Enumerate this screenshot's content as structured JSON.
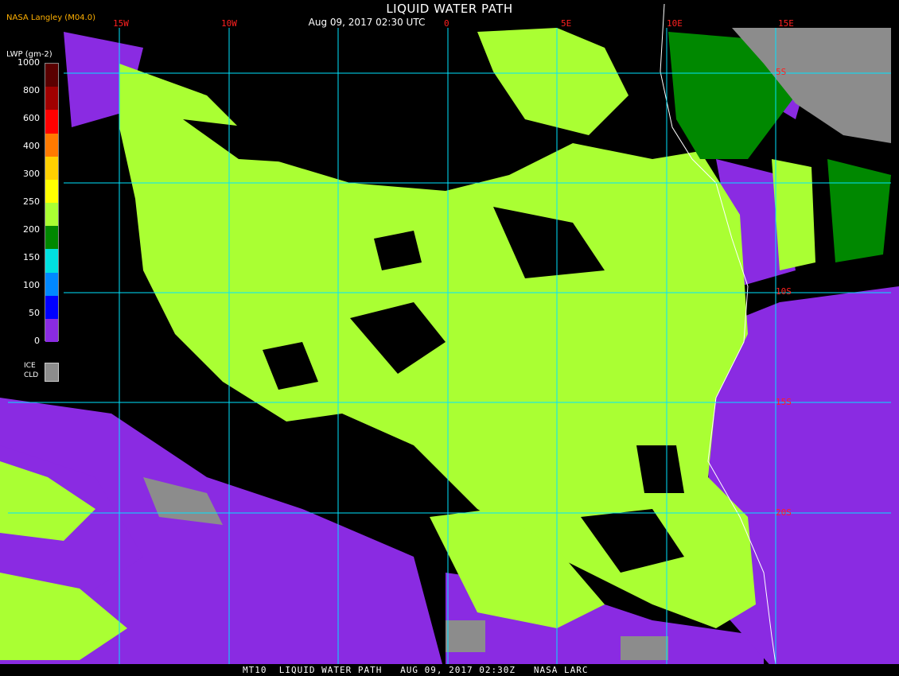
{
  "title": "LIQUID WATER PATH",
  "subtitle": "Aug 09, 2017 02:30 UTC",
  "legend": {
    "title": "NASA Langley (M04.0)",
    "unit": "LWP (gm-2)",
    "labels": [
      "1000",
      "800",
      "600",
      "400",
      "300",
      "250",
      "200",
      "150",
      "100",
      "50",
      "0"
    ],
    "colors": [
      "#5a0000",
      "#a00000",
      "#ff0000",
      "#ff7a00",
      "#ffd000",
      "#ffff00",
      "#aaff33",
      "#008800",
      "#00e0e0",
      "#0088ff",
      "#0000ff",
      "#8a2be2"
    ],
    "ice_line1": "ICE",
    "ice_line2": "CLD",
    "ice_color": "#8c8c8c"
  },
  "grid": {
    "lon_labels": [
      "15W",
      "10W",
      "0",
      "5E",
      "10E",
      "15E"
    ],
    "lat_labels": [
      "5S",
      "10S",
      "15S",
      "20S"
    ]
  },
  "footer": "MT10  LIQUID WATER PATH   AUG 09, 2017 02:30Z   NASA LARC",
  "colors": {
    "ocean": "#000000",
    "low_lwp": "#8a2be2",
    "mid_lwp": "#aaff33",
    "dark_green": "#008800",
    "ice": "#8c8c8c",
    "grid": "#00e5ff",
    "coast": "#ffffff",
    "label_red": "#ff2020"
  }
}
